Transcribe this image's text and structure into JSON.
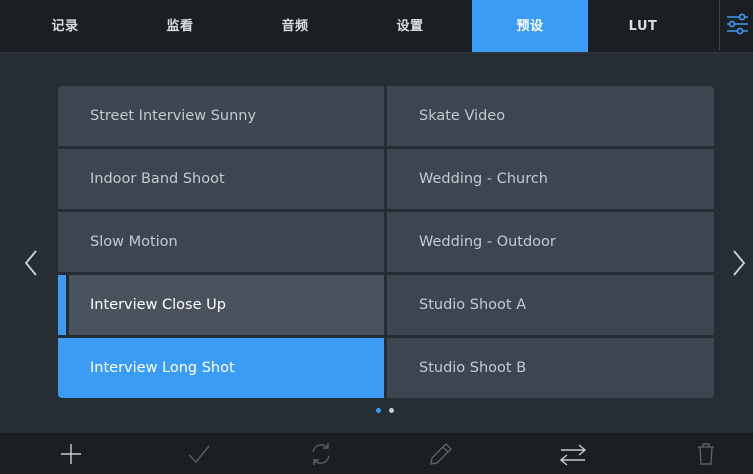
{
  "tabs": [
    {
      "label": "记录"
    },
    {
      "label": "监看"
    },
    {
      "label": "音频"
    },
    {
      "label": "设置"
    },
    {
      "label": "预设"
    },
    {
      "label": "LUT"
    }
  ],
  "active_tab": "预设",
  "presets": {
    "left": [
      "Street Interview Sunny",
      "Indoor Band Shoot",
      "Slow Motion",
      "Interview Close Up",
      "Interview Long Shot"
    ],
    "right": [
      "Skate Video",
      "Wedding  - Church",
      "Wedding - Outdoor",
      "Studio Shoot A",
      "Studio Shoot B"
    ],
    "highlighted": "Interview Long Shot",
    "marked": "Interview Close Up"
  },
  "pagination": {
    "pages": 2,
    "current": 1
  },
  "toolbar": {
    "icons": [
      "plus-icon",
      "check-icon",
      "refresh-icon",
      "pencil-icon",
      "swap-arrows-icon",
      "trash-icon"
    ]
  },
  "colors": {
    "accent": "#3b9cf5",
    "background": "#272d35",
    "tabbar": "#1b1f23",
    "cell": "#3d4550"
  }
}
